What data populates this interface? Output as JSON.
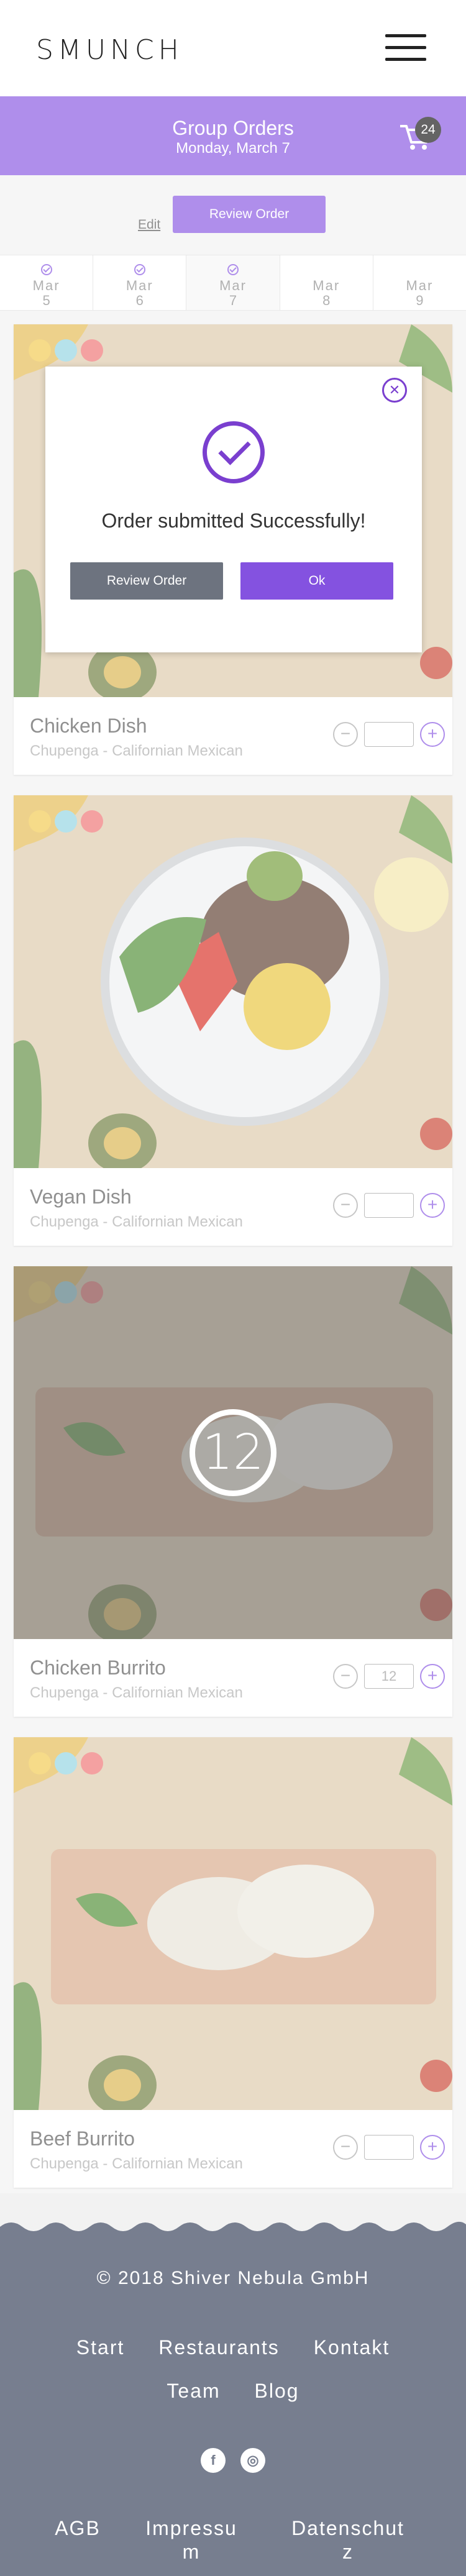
{
  "header": {
    "logo": "SMUNCH",
    "menu_icon": "hamburger-menu-icon"
  },
  "banner": {
    "title": "Group Orders",
    "date": "Monday, March 7",
    "cart_count": "24",
    "cart_icon": "shopping-cart-icon"
  },
  "actions": {
    "edit_label": "Edit",
    "review_label": "Review Order"
  },
  "date_tabs": [
    {
      "month": "Mar",
      "day": "5",
      "checked": true
    },
    {
      "month": "Mar",
      "day": "6",
      "checked": true
    },
    {
      "month": "Mar",
      "day": "7",
      "checked": true,
      "active": true
    },
    {
      "month": "Mar",
      "day": "8",
      "checked": false
    },
    {
      "month": "Mar",
      "day": "9",
      "checked": false
    }
  ],
  "dishes": [
    {
      "name": "Chicken Dish",
      "restaurant": "Chupenga - Californian Mexican",
      "quantity": ""
    },
    {
      "name": "Vegan Dish",
      "restaurant": "Chupenga - Californian Mexican",
      "quantity": ""
    },
    {
      "name": "Chicken Burrito",
      "restaurant": "Chupenga - Californian Mexican",
      "quantity": "12"
    },
    {
      "name": "Beef Burrito",
      "restaurant": "Chupenga - Californian Mexican",
      "quantity": ""
    }
  ],
  "modal": {
    "message": "Order submitted Successfully!",
    "review_label": "Review Order",
    "ok_label": "Ok",
    "close_icon": "close-icon",
    "check_icon": "check-circle-icon"
  },
  "footer": {
    "copyright": "© 2018 Shiver Nebula GmbH",
    "links_row1": [
      "Start",
      "Restaurants",
      "Kontakt"
    ],
    "links_row2": [
      "Team",
      "Blog"
    ],
    "social_icons": [
      "facebook-icon",
      "instagram-icon"
    ],
    "bottom_links": [
      "AGB",
      "Impressu m",
      "Datenschut z"
    ]
  },
  "colors": {
    "accent": "#8452e0",
    "footer_bg": "#777e8f",
    "dot_yellow": "#f1c84b",
    "dot_blue": "#8fd3e0",
    "dot_red": "#ee6f6f"
  }
}
